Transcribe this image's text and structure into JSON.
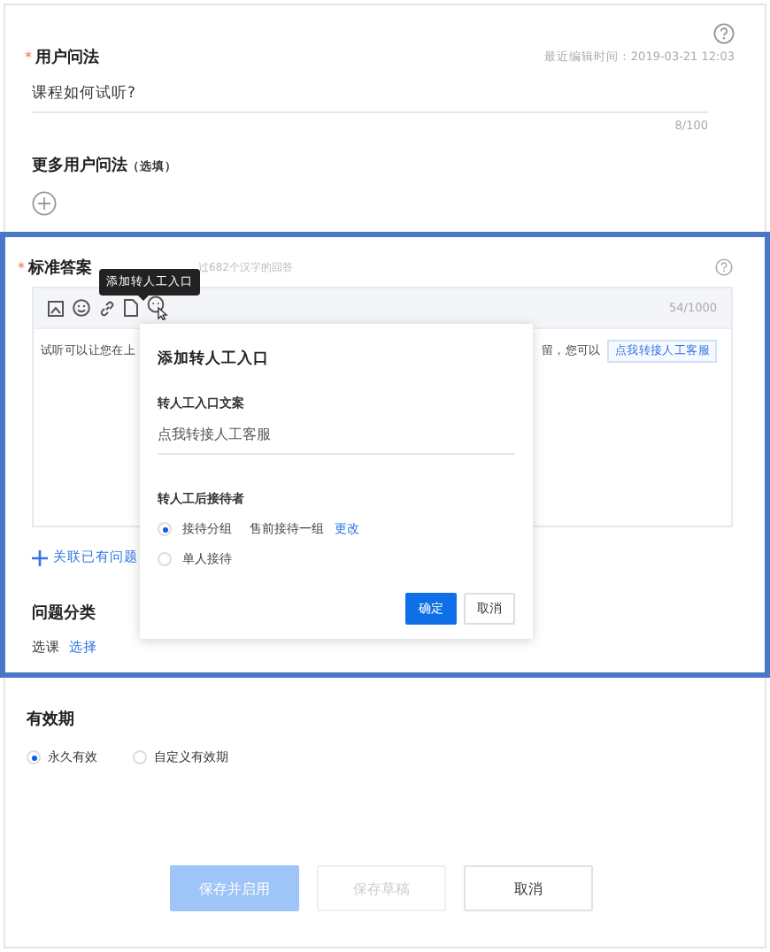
{
  "question": {
    "mark": "*",
    "label": "用户问法",
    "meta": "最近编辑时间：2019-03-21 12:03",
    "value": "课程如何试听?",
    "count": "8/100"
  },
  "more_questions": {
    "label": "更多用户问法",
    "optional": "（选填）"
  },
  "answer": {
    "mark": "*",
    "label": "标准答案",
    "hint": "过682个汉字的回答",
    "count": "54/1000",
    "tooltip": "添加转人工入口",
    "content_start": "试听可以让您在上",
    "content_end": "留，您可以",
    "chip": "点我转接人工客服",
    "link": "关联已有问题"
  },
  "popup": {
    "title": "添加转人工入口",
    "field_label": "转人工入口文案",
    "field_value": "点我转接人工客服",
    "receiver_label": "转人工后接待者",
    "options": [
      {
        "label": "接待分组",
        "detail": "售前接待一组",
        "action": "更改",
        "selected": true
      },
      {
        "label": "单人接待",
        "selected": false
      }
    ],
    "buttons": [
      {
        "label": "确定",
        "kind": "primary"
      },
      {
        "label": "取消",
        "kind": "default"
      }
    ]
  },
  "category": {
    "label": "问题分类",
    "value": "选课",
    "action": "选择"
  },
  "validity": {
    "label": "有效期",
    "options": [
      {
        "label": "永久有效",
        "selected": true
      },
      {
        "label": "自定义有效期",
        "selected": false
      }
    ]
  },
  "footer_buttons": [
    {
      "label": "保存并启用",
      "kind": "primary",
      "disabled": true
    },
    {
      "label": "保存草稿",
      "kind": "default",
      "disabled": true
    },
    {
      "label": "取消",
      "kind": "default",
      "disabled": false
    }
  ]
}
